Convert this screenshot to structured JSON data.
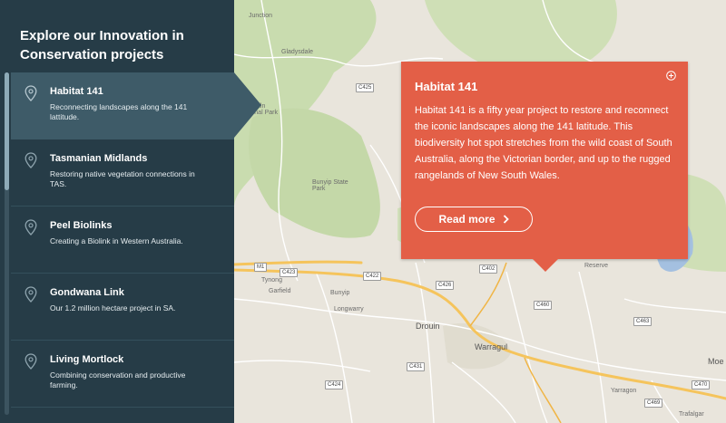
{
  "sidebar": {
    "title": "Explore our Innovation in Conservation projects",
    "projects": [
      {
        "name": "Habitat 141",
        "desc": "Reconnecting landscapes along the 141 lattitude.",
        "active": true
      },
      {
        "name": "Tasmanian Midlands",
        "desc": "Restoring native vegetation connections in TAS.",
        "active": false
      },
      {
        "name": "Peel Biolinks",
        "desc": "Creating a Biolink in Western Australia.",
        "active": false
      },
      {
        "name": "Gondwana Link",
        "desc": "Our 1.2 million hectare project in SA.",
        "active": false
      },
      {
        "name": "Living Mortlock",
        "desc": "Combining conservation and productive farming.",
        "active": false
      }
    ]
  },
  "popup": {
    "title": "Habitat 141",
    "body": "Habitat 141 is a fifty year project to restore and reconnect the iconic landscapes along the 141 latitude. This biodiversity hot spot stretches from the wild coast of South Australia, along the Victorian border, and up to the rugged rangelands of New South Wales.",
    "read_more": "Read more",
    "close_icon": "plus-circle-icon"
  },
  "map": {
    "labels": {
      "junction": "Junction",
      "gladysdale": "Gladysdale",
      "kurth_kiln": "Kurth Kiln Regional Park",
      "bunyip": "Bunyip State Park",
      "garfield": "Garfield",
      "bunyip_town": "Bunyip",
      "longwarry": "Longwarry",
      "drouin": "Drouin",
      "warragul": "Warragul",
      "tynong": "Tynong",
      "yarragon": "Yarragon",
      "trafalgar": "Trafalgar",
      "moe": "Moe",
      "reserve": "Reserve"
    },
    "shields": {
      "c425a": "C425",
      "c422": "C422",
      "c426": "C426",
      "c402": "C402",
      "c423": "C423",
      "c424": "C424",
      "c431": "C431",
      "c460": "C460",
      "c463": "C463",
      "c101": "M1",
      "c469": "C469",
      "c470": "C470"
    },
    "colors": {
      "land": "#e9e5dc",
      "park": "#c9dcaf",
      "highway": "#f5c45c",
      "water": "#a4c0e0"
    }
  },
  "colors": {
    "sidebar_bg": "#263c47",
    "active_item": "#3e5b68",
    "popup_bg": "#e35f47"
  }
}
